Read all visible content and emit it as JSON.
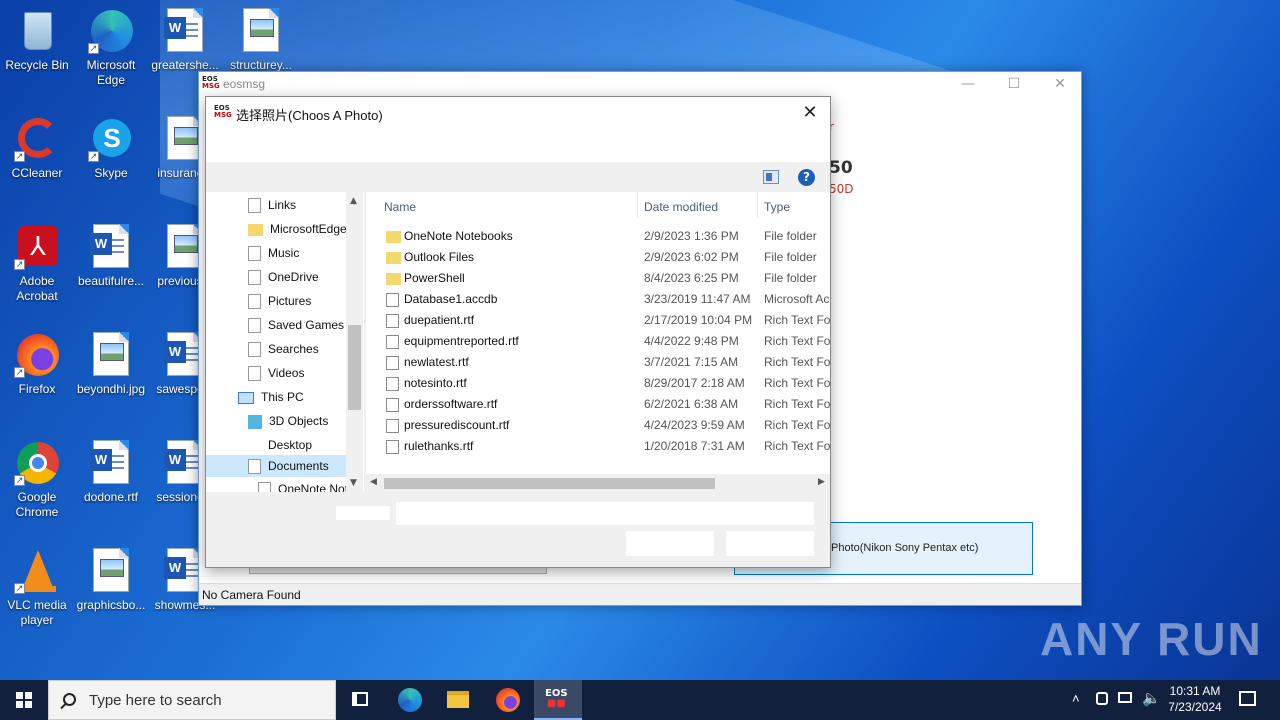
{
  "desktop": {
    "icons": [
      {
        "label": "Recycle Bin",
        "icon": "recycle-bin-icon"
      },
      {
        "label": "Microsoft Edge",
        "icon": "edge-icon"
      },
      {
        "label": "greatershe...",
        "icon": "word-doc-icon"
      },
      {
        "label": "structurey...",
        "icon": "image-file-icon"
      },
      {
        "label": "CCleaner",
        "icon": "ccleaner-icon"
      },
      {
        "label": "Skype",
        "icon": "skype-icon"
      },
      {
        "label": "insuranc...",
        "icon": "image-file-icon"
      },
      {
        "label": "Adobe Acrobat",
        "icon": "acrobat-icon"
      },
      {
        "label": "beautifulre...",
        "icon": "word-doc-icon"
      },
      {
        "label": "previous...",
        "icon": "image-file-icon"
      },
      {
        "label": "Firefox",
        "icon": "firefox-icon"
      },
      {
        "label": "beyondhi.jpg",
        "icon": "image-file-icon"
      },
      {
        "label": "sawespe...",
        "icon": "word-doc-icon"
      },
      {
        "label": "Google Chrome",
        "icon": "chrome-icon"
      },
      {
        "label": "dodone.rtf",
        "icon": "word-doc-icon"
      },
      {
        "label": "sessione...",
        "icon": "word-doc-icon"
      },
      {
        "label": "VLC media player",
        "icon": "vlc-icon"
      },
      {
        "label": "graphicsbo...",
        "icon": "image-file-icon"
      },
      {
        "label": "showmes...",
        "icon": "word-doc-icon"
      }
    ]
  },
  "main_window": {
    "logo": "EOS MSG",
    "title": "eosmsg",
    "controls": {
      "minimize": "—",
      "maximize": "☐",
      "close": "✕"
    },
    "red_text_1": "r",
    "big_text": "50",
    "red_text_2": "50D",
    "right_button_label": "Photo(Nikon Sony Pentax etc)",
    "status": "No Camera Found"
  },
  "dialog": {
    "logo": "EOS MSG",
    "title": "选择照片(Choos A Photo)",
    "close": "✕",
    "help": "?",
    "nav_items": [
      {
        "label": "Links",
        "icon": "file"
      },
      {
        "label": "MicrosoftEdge",
        "icon": "folder"
      },
      {
        "label": "Music",
        "icon": "file"
      },
      {
        "label": "OneDrive",
        "icon": "file"
      },
      {
        "label": "Pictures",
        "icon": "file"
      },
      {
        "label": "Saved Games",
        "icon": "file"
      },
      {
        "label": "Searches",
        "icon": "file"
      },
      {
        "label": "Videos",
        "icon": "file"
      },
      {
        "label": "This PC",
        "icon": "pc"
      },
      {
        "label": "3D Objects",
        "icon": "cube"
      },
      {
        "label": "Desktop",
        "icon": "none"
      },
      {
        "label": "Documents",
        "icon": "file"
      },
      {
        "label": "OneNote Not...",
        "icon": "file"
      }
    ],
    "columns": {
      "name": "Name",
      "date": "Date modified",
      "type": "Type"
    },
    "files": [
      {
        "name": "OneNote Notebooks",
        "date": "2/9/2023 1:36 PM",
        "type": "File folder",
        "folder": true
      },
      {
        "name": "Outlook Files",
        "date": "2/9/2023 6:02 PM",
        "type": "File folder",
        "folder": true
      },
      {
        "name": "PowerShell",
        "date": "8/4/2023 6:25 PM",
        "type": "File folder",
        "folder": true
      },
      {
        "name": "Database1.accdb",
        "date": "3/23/2019 11:47 AM",
        "type": "Microsoft Ac",
        "folder": false
      },
      {
        "name": "duepatient.rtf",
        "date": "2/17/2019 10:04 PM",
        "type": "Rich Text For",
        "folder": false
      },
      {
        "name": "equipmentreported.rtf",
        "date": "4/4/2022 9:48 PM",
        "type": "Rich Text For",
        "folder": false
      },
      {
        "name": "newlatest.rtf",
        "date": "3/7/2021 7:15 AM",
        "type": "Rich Text For",
        "folder": false
      },
      {
        "name": "notesinto.rtf",
        "date": "8/29/2017 2:18 AM",
        "type": "Rich Text For",
        "folder": false
      },
      {
        "name": "orderssoftware.rtf",
        "date": "6/2/2021 6:38 AM",
        "type": "Rich Text For",
        "folder": false
      },
      {
        "name": "pressurediscount.rtf",
        "date": "4/24/2023 9:59 AM",
        "type": "Rich Text For",
        "folder": false
      },
      {
        "name": "rulethanks.rtf",
        "date": "1/20/2018 7:31 AM",
        "type": "Rich Text For",
        "folder": false
      }
    ]
  },
  "taskbar": {
    "search_placeholder": "Type here to search",
    "apps": [
      "task-view-icon",
      "edge-icon",
      "file-explorer-icon",
      "firefox-icon",
      "eosmsg-icon"
    ],
    "eos_label": "EOS",
    "time": "10:31 AM",
    "date": "7/23/2024"
  },
  "watermark": "ANY RUN",
  "colors": {
    "accent": "#0078d7",
    "selection": "#cce8ff",
    "red": "#c0392b",
    "taskbar": "#10203d"
  }
}
